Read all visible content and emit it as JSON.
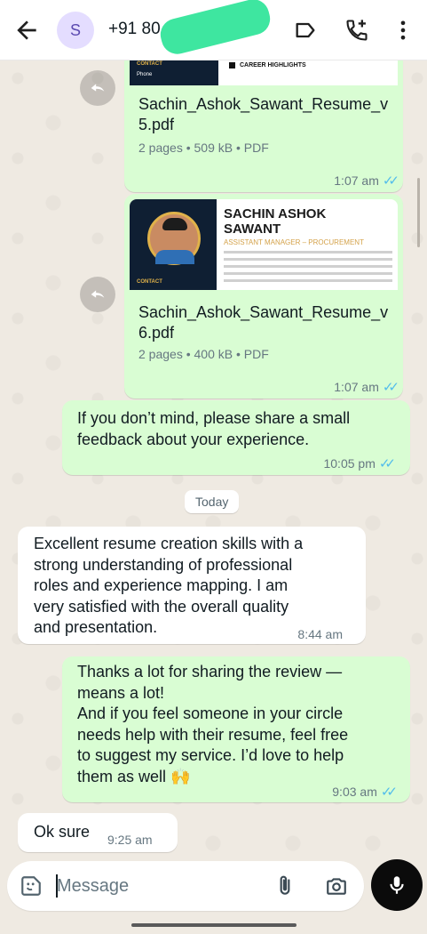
{
  "header": {
    "avatar_letter": "S",
    "contact_name": "+91 80",
    "icons": [
      "back-arrow-icon",
      "label-icon",
      "call-add-icon",
      "more-vert-icon"
    ]
  },
  "messages": {
    "doc1": {
      "preview_contact": "CONTACT",
      "preview_phone": "Phone",
      "preview_highlights": "CAREER HIGHLIGHTS",
      "file_name_1": "Sachin_Ashok_Sawant_Resume_v",
      "file_name_2": "5.pdf",
      "info": "2 pages • 509 kB • PDF",
      "time": "1:07 am"
    },
    "doc2": {
      "preview_name_1": "SACHIN ASHOK",
      "preview_name_2": "SAWANT",
      "preview_role": "ASSISTANT MANAGER – PROCUREMENT",
      "preview_contact": "CONTACT",
      "file_name_1": "Sachin_Ashok_Sawant_Resume_v",
      "file_name_2": "6.pdf",
      "info": "2 pages • 400 kB • PDF",
      "time": "1:07 am"
    },
    "feedback_request": {
      "line1": "If you don’t mind, please share a small",
      "line2": "feedback about your experience.",
      "time": "10:05 pm"
    },
    "date_chip": "Today",
    "review": {
      "line1": "Excellent resume creation skills with a",
      "line2": "strong understanding of professional",
      "line3": "roles and experience mapping. I am",
      "line4": "very satisfied with the overall quality",
      "line5": "and presentation.",
      "time": "8:44 am"
    },
    "thanks": {
      "line1": "Thanks a lot for sharing the review —",
      "line2": "means a lot!",
      "line3": "And if you feel someone in your circle",
      "line4": "needs help with their resume, feel free",
      "line5": "to suggest my service. I’d love to help",
      "line6": "them as well 🙌",
      "time": "9:03 am"
    },
    "ok": {
      "text": "Ok sure",
      "time": "9:25 am"
    }
  },
  "composer": {
    "placeholder": "Message",
    "icons": [
      "sticker-icon",
      "attach-icon",
      "camera-icon",
      "mic-icon"
    ]
  },
  "colors": {
    "outgoing_bubble": "#d9fdd3",
    "incoming_bubble": "#ffffff",
    "read_ticks": "#53bdeb",
    "chat_background": "#efeae2"
  }
}
